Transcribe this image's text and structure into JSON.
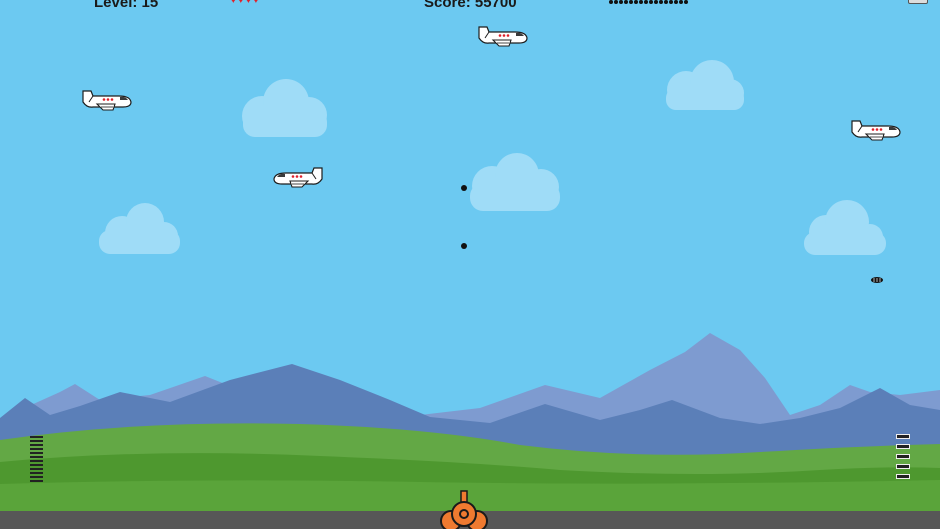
{
  "hud": {
    "level": "Level: 15",
    "score": "Score: 55700",
    "lives": 4,
    "ammo_count": 16
  },
  "left_gauge_segments": 12,
  "right_gauge_segments": 5,
  "icons": {
    "heart": "heart-icon",
    "plane": "cargo-plane",
    "cannon": "orange-cannon"
  },
  "colors": {
    "sky": "#6cc9f1",
    "cloud": "#9fdcf7",
    "mountain_light": "#7e9bd0",
    "mountain_dark": "#5b7fb8",
    "hill_far": "#63a845",
    "hill_near": "#4e982f",
    "road": "#575757",
    "cannon": "#ef7a30",
    "heart": "#e0202a"
  }
}
